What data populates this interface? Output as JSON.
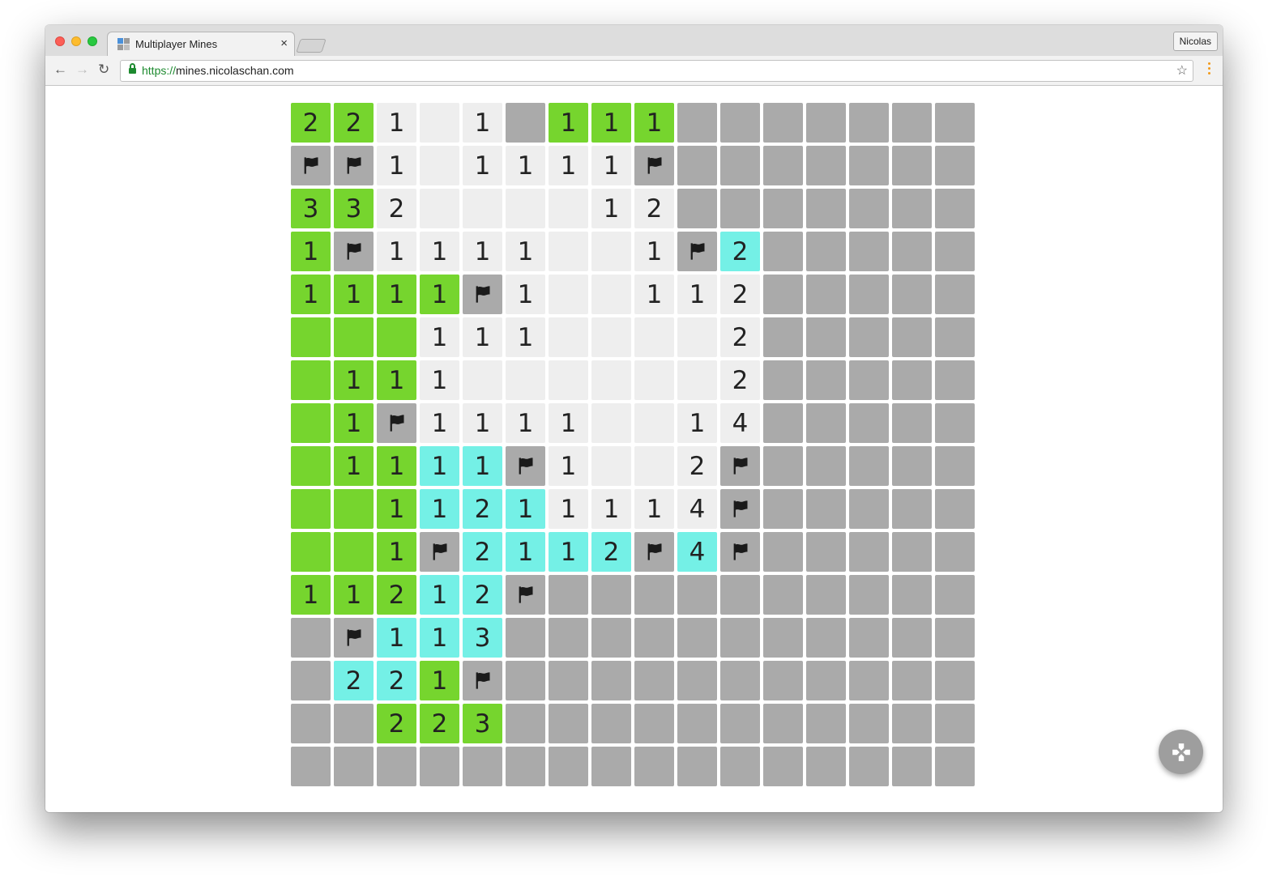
{
  "browser": {
    "tab_title": "Multiplayer Mines",
    "tab_close": "×",
    "profile_name": "Nicolas",
    "url_scheme": "https://",
    "url_host": "mines.nicolaschan.com",
    "back_icon": "←",
    "forward_icon": "→",
    "reload_icon": "↻",
    "star_icon": "☆"
  },
  "colors": {
    "hidden": "#aaaaaa",
    "opened": "#eeeeee",
    "player_green": "#76d52e",
    "player_cyan": "#74f0e6",
    "flag": "#1a1a1a"
  },
  "legend": {
    "h": "hidden",
    "o": "opened-empty",
    "F": "flag",
    "gN": "opened by green player showing N",
    "cN": "opened by cyan player showing N",
    "oN": "opened showing N"
  },
  "board": {
    "rows": 16,
    "cols": 16,
    "cells": [
      [
        "g2",
        "g2",
        "o1",
        "o",
        "o1",
        "h",
        "g1",
        "g1",
        "g1",
        "h",
        "h",
        "h",
        "h",
        "h",
        "h",
        "h"
      ],
      [
        "F",
        "F",
        "o1",
        "o",
        "o1",
        "o1",
        "o1",
        "o1",
        "F",
        "h",
        "h",
        "h",
        "h",
        "h",
        "h",
        "h"
      ],
      [
        "g3",
        "g3",
        "o2",
        "o",
        "o",
        "o",
        "o",
        "o1",
        "o2",
        "h",
        "h",
        "h",
        "h",
        "h",
        "h",
        "h"
      ],
      [
        "g1",
        "F",
        "o1",
        "o1",
        "o1",
        "o1",
        "o",
        "o",
        "o1",
        "F",
        "c2",
        "h",
        "h",
        "h",
        "h",
        "h"
      ],
      [
        "g1",
        "g1",
        "g1",
        "g1",
        "F",
        "o1",
        "o",
        "o",
        "o1",
        "o1",
        "o2",
        "h",
        "h",
        "h",
        "h",
        "h"
      ],
      [
        "g",
        "g",
        "g",
        "o1",
        "o1",
        "o1",
        "o",
        "o",
        "o",
        "o",
        "o2",
        "h",
        "h",
        "h",
        "h",
        "h"
      ],
      [
        "g",
        "g1",
        "g1",
        "o1",
        "o",
        "o",
        "o",
        "o",
        "o",
        "o",
        "o2",
        "h",
        "h",
        "h",
        "h",
        "h"
      ],
      [
        "g",
        "g1",
        "F",
        "o1",
        "o1",
        "o1",
        "o1",
        "o",
        "o",
        "o1",
        "o4",
        "h",
        "h",
        "h",
        "h",
        "h"
      ],
      [
        "g",
        "g1",
        "g1",
        "c1",
        "c1",
        "F",
        "o1",
        "o",
        "o",
        "o2",
        "F",
        "h",
        "h",
        "h",
        "h",
        "h"
      ],
      [
        "g",
        "g",
        "g1",
        "c1",
        "c2",
        "c1",
        "o1",
        "o1",
        "o1",
        "o4",
        "F",
        "h",
        "h",
        "h",
        "h",
        "h"
      ],
      [
        "g",
        "g",
        "g1",
        "F",
        "c2",
        "c1",
        "c1",
        "c2",
        "F",
        "c4",
        "F",
        "h",
        "h",
        "h",
        "h",
        "h"
      ],
      [
        "g1",
        "g1",
        "g2",
        "c1",
        "c2",
        "F",
        "h",
        "h",
        "h",
        "h",
        "h",
        "h",
        "h",
        "h",
        "h",
        "h"
      ],
      [
        "h",
        "F",
        "c1",
        "c1",
        "c3",
        "h",
        "h",
        "h",
        "h",
        "h",
        "h",
        "h",
        "h",
        "h",
        "h",
        "h"
      ],
      [
        "h",
        "c2",
        "c2",
        "g1",
        "F",
        "h",
        "h",
        "h",
        "h",
        "h",
        "h",
        "h",
        "h",
        "h",
        "h",
        "h"
      ],
      [
        "h",
        "h",
        "g2",
        "g2",
        "g3",
        "h",
        "h",
        "h",
        "h",
        "h",
        "h",
        "h",
        "h",
        "h",
        "h",
        "h"
      ],
      [
        "h",
        "h",
        "h",
        "h",
        "h",
        "h",
        "h",
        "h",
        "h",
        "h",
        "h",
        "h",
        "h",
        "h",
        "h",
        "h"
      ]
    ]
  },
  "fab": {
    "icon": "gamepad-icon"
  }
}
